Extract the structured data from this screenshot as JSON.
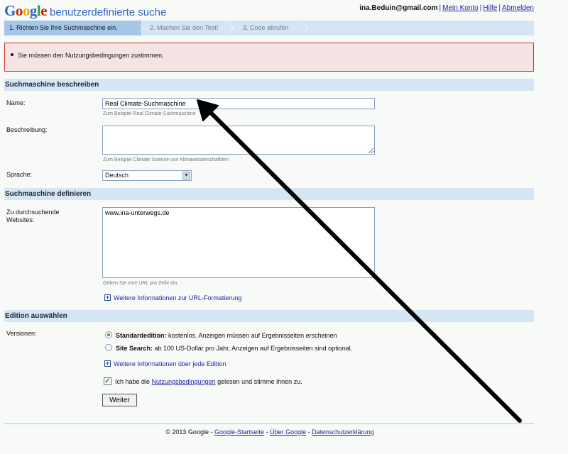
{
  "header": {
    "logo_text": "Google",
    "logo_colors": [
      "#3366cc",
      "#cc2200",
      "#eeaa00",
      "#3366cc",
      "#339933",
      "#cc2200"
    ],
    "subtitle": "benutzerdefinierte suche",
    "email": "ina.Beduin@gmail.com",
    "links": [
      "Mein Konto",
      "Hilfe",
      "Abmelden"
    ]
  },
  "steps": [
    {
      "label": "1. Richten Sie Ihre Suchmaschine ein.",
      "active": true
    },
    {
      "label": "2. Machen Sie den Test!",
      "active": false
    },
    {
      "label": "3. Code abrufen",
      "active": false
    }
  ],
  "error": {
    "message": "Sie müssen den Nutzungsbedingungen zustimmen."
  },
  "describe": {
    "title": "Suchmaschine beschreiben",
    "name_label": "Name:",
    "name_value": "Real Climate-Suchmaschine",
    "name_hint": "Zum Beispiel Real Climate-Suchmaschine",
    "desc_label": "Beschreibung:",
    "desc_value": "",
    "desc_hint": "Zum Beispiel Climate Science von Klimawissenschaftlern",
    "lang_label": "Sprache:",
    "lang_value": "Deutsch"
  },
  "define": {
    "title": "Suchmaschine definieren",
    "sites_label": "Zu durchsuchende Websites:",
    "sites_value": "www.ina-unterwegs.de",
    "sites_hint": "Geben Sie eine URL pro Zeile ein.",
    "more_info": "Weitere Informationen zur URL-Formatierung"
  },
  "edition": {
    "title": "Edition auswählen",
    "versions_label": "Versionen:",
    "options": [
      {
        "bold": "Standardedition:",
        "text": " kostenlos. Anzeigen müssen auf Ergebnisseiten erscheinen",
        "checked": true
      },
      {
        "bold": "Site Search:",
        "text": " ab 100 US-Dollar pro Jahr, Anzeigen auf Ergebnisseiten sind optional.",
        "checked": false
      }
    ],
    "more_info": "Weitere Informationen über jede Edition",
    "terms_pre": "Ich habe die ",
    "terms_link": "Nutzungsbedingungen",
    "terms_post": " gelesen und stimme ihnen zu.",
    "terms_checked": true,
    "submit": "Weiter"
  },
  "footer": {
    "copyright": "© 2013 Google",
    "links": [
      "Google-Startseite",
      "Über Google",
      "Datenschutzerklärung"
    ],
    "separator": "-"
  },
  "overlay": {
    "arrow_color": "#000000"
  }
}
